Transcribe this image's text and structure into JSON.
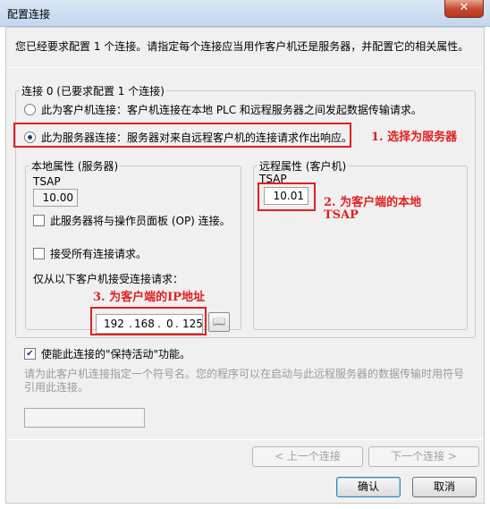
{
  "window": {
    "title": "配置连接",
    "close_label": "✕"
  },
  "intro": "您已经要求配置 1 个连接。请指定每个连接应当用作客户机还是服务器，并配置它的相关属性。",
  "connection_group": {
    "legend": "连接 0 (已要求配置 1 个连接)",
    "option_client": "此为客户机连接：客户机连接在本地 PLC 和远程服务器之间发起数据传输请求。",
    "option_server": "此为服务器连接：服务器对来自远程客户机的连接请求作出响应。",
    "selected": "server"
  },
  "local": {
    "legend": "本地属性 (服务器)",
    "tsap_label": "TSAP",
    "tsap_value": "10.00",
    "op_checkbox": "此服务器将与操作员面板 (OP) 连接。",
    "accept_all_checkbox": "接受所有连接请求。",
    "accept_from_label": "仅从以下客户机接受连接请求：",
    "ip": [
      "192",
      "168",
      "0",
      "125"
    ],
    "address_book_icon": "address-book-icon"
  },
  "remote": {
    "legend": "远程属性 (客户机)",
    "tsap_label": "TSAP",
    "tsap_value": "10.01"
  },
  "keepalive_checkbox": "使能此连接的\"保持活动\"功能。",
  "symbol_hint": "请为此客户机连接指定一个符号名。您的程序可以在启动与此远程服务器的数据传输时用符号引用此连接。",
  "annotations": {
    "a1": "1. 选择为服务器",
    "a2_line1": "2. 为客户端的本地",
    "a2_line2": "TSAP",
    "a3": "3. 为客户端的IP地址"
  },
  "buttons": {
    "prev": "< 上一个连接",
    "next": "下一个连接 >",
    "ok": "确认",
    "cancel": "取消"
  },
  "colors": {
    "annotation": "#e02020"
  }
}
